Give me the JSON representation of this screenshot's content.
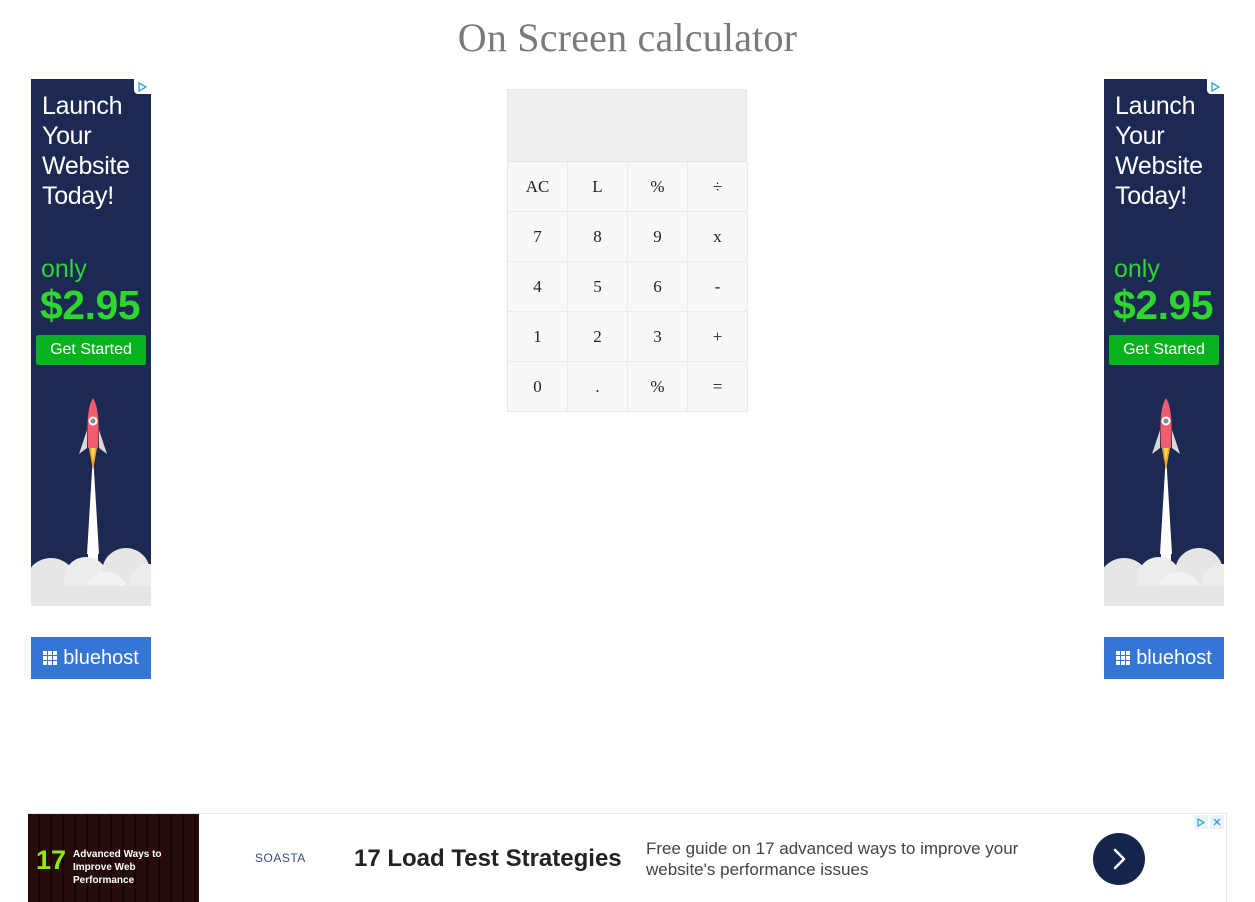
{
  "page": {
    "title": "On Screen calculator"
  },
  "calculator": {
    "display": "",
    "keys": [
      "AC",
      "L",
      "%",
      "÷",
      "7",
      "8",
      "9",
      "x",
      "4",
      "5",
      "6",
      "-",
      "1",
      "2",
      "3",
      "+",
      "0",
      ".",
      "%",
      "="
    ]
  },
  "side_ad": {
    "headline": "Launch Your Website Today!",
    "only": "only",
    "price": "$2.95",
    "cta": "Get Started",
    "brand": "bluehost",
    "colors": {
      "background": "#1c2953",
      "price": "#2ed62e",
      "cta": "#07b31d",
      "brand_bar": "#3575d3"
    }
  },
  "bottom_ad": {
    "thumb_number": "17",
    "thumb_text": "Advanced Ways to Improve Web Performance",
    "logo": "SOASTA",
    "headline": "17 Load Test Strategies",
    "description": "Free guide on 17 advanced ways to improve your website's performance issues",
    "button_icon": "chevron-right-icon"
  },
  "icons": {
    "ad_choices": "ad-choices-icon",
    "close": "close-icon"
  }
}
